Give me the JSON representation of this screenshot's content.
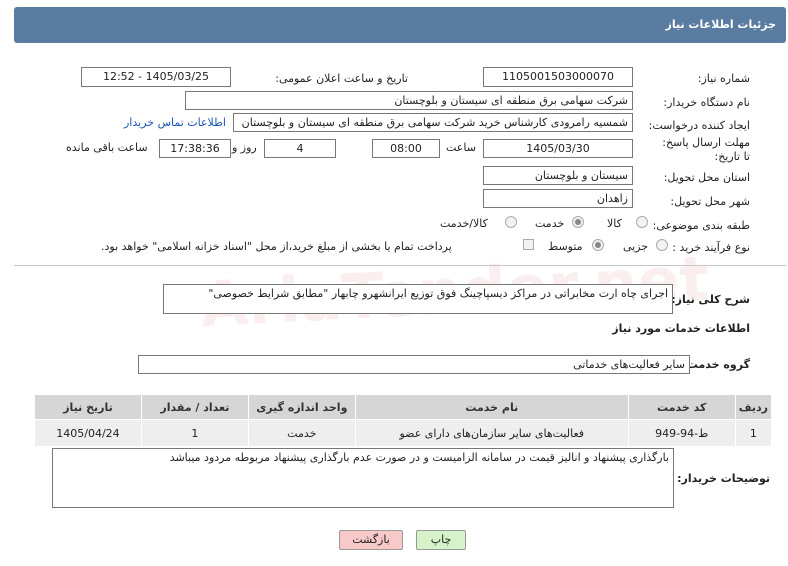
{
  "header": {
    "title": "جزئیات اطلاعات نیاز"
  },
  "watermark": "AriaTender.net",
  "fields": {
    "need_number_label": "شماره نیاز:",
    "need_number": "1105001503000070",
    "announce_label": "تاریخ و ساعت اعلان عمومی:",
    "announce_value": "1405/03/25 - 12:52",
    "buyer_org_label": "نام دستگاه خریدار:",
    "buyer_org": "شرکت سهامی برق منطقه ای سیستان و بلوچستان",
    "requester_label": "ایجاد کننده درخواست:",
    "requester": "شمسیه رامرودی کارشناس خرید شرکت سهامی برق منطقه ای سیستان و بلوچستان",
    "contact_link": "اطلاعات تماس خریدار",
    "deadline_label": "مهلت ارسال پاسخ: تا تاریخ:",
    "deadline_date": "1405/03/30",
    "time_label": "ساعت",
    "deadline_time": "08:00",
    "days_value": "4",
    "days_label": "روز و",
    "remaining_time": "17:38:36",
    "remaining_label": "ساعت باقی مانده",
    "province_label": "استان محل تحویل:",
    "province": "سیستان و بلوچستان",
    "city_label": "شهر محل تحویل:",
    "city": "زاهدان",
    "category_label": "طبقه بندی موضوعی:",
    "category_options": [
      "کالا",
      "خدمت",
      "کالا/خدمت"
    ],
    "category_selected": "خدمت",
    "process_label": "نوع فرآیند خرید :",
    "process_options": [
      "جزیی",
      "متوسط"
    ],
    "process_selected": "متوسط",
    "payment_note": "پرداخت تمام یا بخشی از مبلغ خرید،از محل \"اسناد خزانه اسلامی\" خواهد بود."
  },
  "description": {
    "label": "شرح کلی نیاز:",
    "text": "اجرای چاه ارت مخابراتی در مراکز دیسپاچینگ فوق توزیع ایرانشهرو چابهار \"مطابق شرایط خصوصی\""
  },
  "services": {
    "section_title": "اطلاعات خدمات مورد نیاز",
    "group_label": "گروه خدمت:",
    "group_value": "سایر فعالیت‌های خدماتی",
    "columns": [
      "ردیف",
      "کد خدمت",
      "نام خدمت",
      "واحد اندازه گیری",
      "تعداد / مقدار",
      "تاریخ نیاز"
    ],
    "rows": [
      {
        "index": "1",
        "code": "ط-94-949",
        "name": "فعالیت‌های سایر سازمان‌های دارای عضو",
        "unit": "خدمت",
        "qty": "1",
        "date": "1405/04/24"
      }
    ]
  },
  "buyer_notes": {
    "label": "توضیحات خریدار:",
    "text": "بارگذاری پیشنهاد و انالیز قیمت در سامانه الزامیست و در صورت عدم بارگذاری پیشنهاد مربوطه مردود میباشد"
  },
  "buttons": {
    "print": "چاپ",
    "back": "بازگشت"
  },
  "colors": {
    "header_bg": "#5a7ca0",
    "link": "#1a55b5",
    "back_btn_bg": "#f7c9c9",
    "print_btn_bg": "#d6f2c8"
  }
}
